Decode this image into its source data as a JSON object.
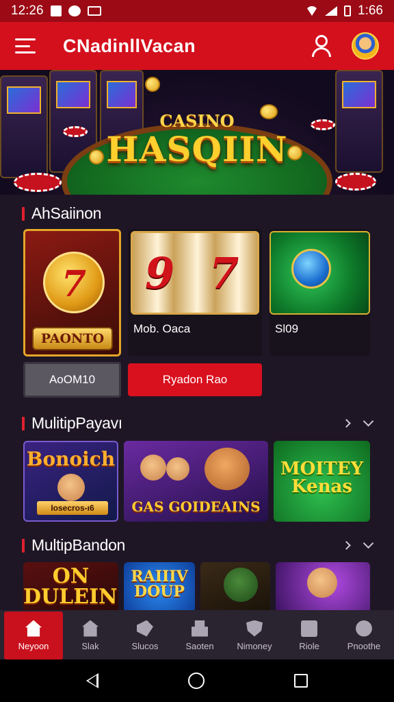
{
  "status_bar": {
    "time_left": "12:26",
    "time_right": "1:66"
  },
  "app_bar": {
    "title": "CNadinllVacan"
  },
  "hero": {
    "script_text": "CASINO",
    "title": "HASQIIN"
  },
  "sections": [
    {
      "title": "AhSaiinon"
    },
    {
      "title": "MulitipPayavı"
    },
    {
      "title": "MultipBandon"
    }
  ],
  "featured": {
    "card1_plate": "PAONTO",
    "card1_badge": "7",
    "card2_reel_left": "9",
    "card2_reel_right": "7",
    "card2_label": "Mob. Oaca",
    "card3_label": "Sl09",
    "secondary_button": "AoOM10",
    "primary_button": "Ryadon Rao"
  },
  "multiplayer": {
    "card1_title": "Bonoich",
    "card1_plate": "Iosecros-ı6",
    "card2_title": "GAS GOIDEAINS",
    "card3_title": "MOITEY Kenas"
  },
  "multiplayer2": {
    "card1_title": "ON DULEINS",
    "card2_title": "RAIIIV DOUP"
  },
  "bottom_nav": [
    {
      "label": "Neyoon",
      "icon": "home-icon"
    },
    {
      "label": "Slak",
      "icon": "bank-icon"
    },
    {
      "label": "Slucos",
      "icon": "tag-icon"
    },
    {
      "label": "Saoten",
      "icon": "lock-icon"
    },
    {
      "label": "Nimoney",
      "icon": "shield-icon"
    },
    {
      "label": "Riole",
      "icon": "card-icon"
    },
    {
      "label": "Pnoothe",
      "icon": "person-icon"
    }
  ],
  "colors": {
    "brand_red": "#d4101d",
    "status_red": "#9b0a15",
    "background": "#1e1625",
    "nav_bg": "#2a2330"
  }
}
